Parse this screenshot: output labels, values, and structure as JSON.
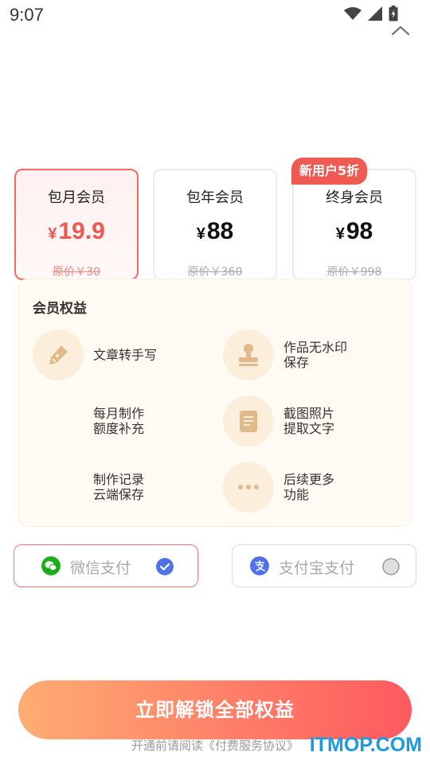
{
  "status_bar": {
    "time": "9:07"
  },
  "plans": [
    {
      "name": "包月会员",
      "currency": "¥",
      "price": "19.9",
      "original": "原价￥30",
      "selected": true
    },
    {
      "name": "包年会员",
      "currency": "¥",
      "price": "88",
      "original": "原价￥360",
      "selected": false
    },
    {
      "name": "终身会员",
      "currency": "¥",
      "price": "98",
      "original": "原价￥998",
      "selected": false
    }
  ],
  "promo_badge": "新用户5折",
  "benefits": {
    "title": "会员权益",
    "items": [
      {
        "text": "文章转手写",
        "icon": "pen-icon"
      },
      {
        "text": "作品无水印\n保存",
        "icon": "stamp-icon"
      },
      {
        "text": "每月制作\n额度补充",
        "icon": ""
      },
      {
        "text": "截图照片\n提取文字",
        "icon": "document-icon"
      },
      {
        "text": "制作记录\n云端保存",
        "icon": ""
      },
      {
        "text": "后续更多\n功能",
        "icon": "more-icon"
      }
    ]
  },
  "payment": {
    "wechat": {
      "label": "微信支付",
      "selected": true
    },
    "alipay": {
      "label": "支付宝支付",
      "selected": false
    }
  },
  "cta": {
    "label": "立即解锁全部权益"
  },
  "agreement": {
    "prefix": "开通前请阅读",
    "link": "《付费服务协议》"
  },
  "watermark": "ITMOP.COM",
  "colors": {
    "accent": "#f0574f",
    "benefit_bg": "#fffbf2",
    "icon_bg": "#fbeedb",
    "icon_fg": "#e2b98a",
    "wechat": "#1aad19",
    "alipay_check": "#4f72e8"
  }
}
